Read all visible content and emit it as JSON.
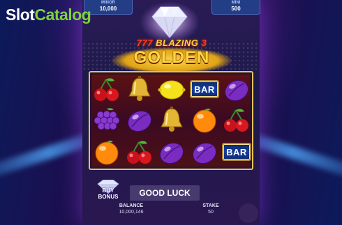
{
  "watermark": {
    "part1": "Slot",
    "part2": "Catalog"
  },
  "jackpots": {
    "minor": {
      "label": "MINOR",
      "value": "10,000"
    },
    "mini": {
      "label": "MINI",
      "value": "500"
    }
  },
  "game_title": {
    "line1_prefix": "777",
    "line1": "BLAZING",
    "line1_suffix": "3",
    "line2": "GOLDEN"
  },
  "reels": {
    "rows": [
      [
        "cherry",
        "bell",
        "lemon",
        "bar",
        "plum"
      ],
      [
        "grapes",
        "plum",
        "bell",
        "orange",
        "cherry"
      ],
      [
        "orange",
        "cherry",
        "plum",
        "plum",
        "bar"
      ]
    ],
    "bar_label": "BAR"
  },
  "buy_bonus": {
    "line1": "BUY",
    "line2": "BONUS"
  },
  "message": "GOOD LUCK",
  "balance": {
    "label": "BALANCE",
    "value": "10,000,146"
  },
  "stake": {
    "label": "STAKE",
    "value": "50"
  },
  "colors": {
    "frame": "#e6c15c",
    "jackpot_panel": "#243e86",
    "watermark_accent": "#7cd13f"
  }
}
